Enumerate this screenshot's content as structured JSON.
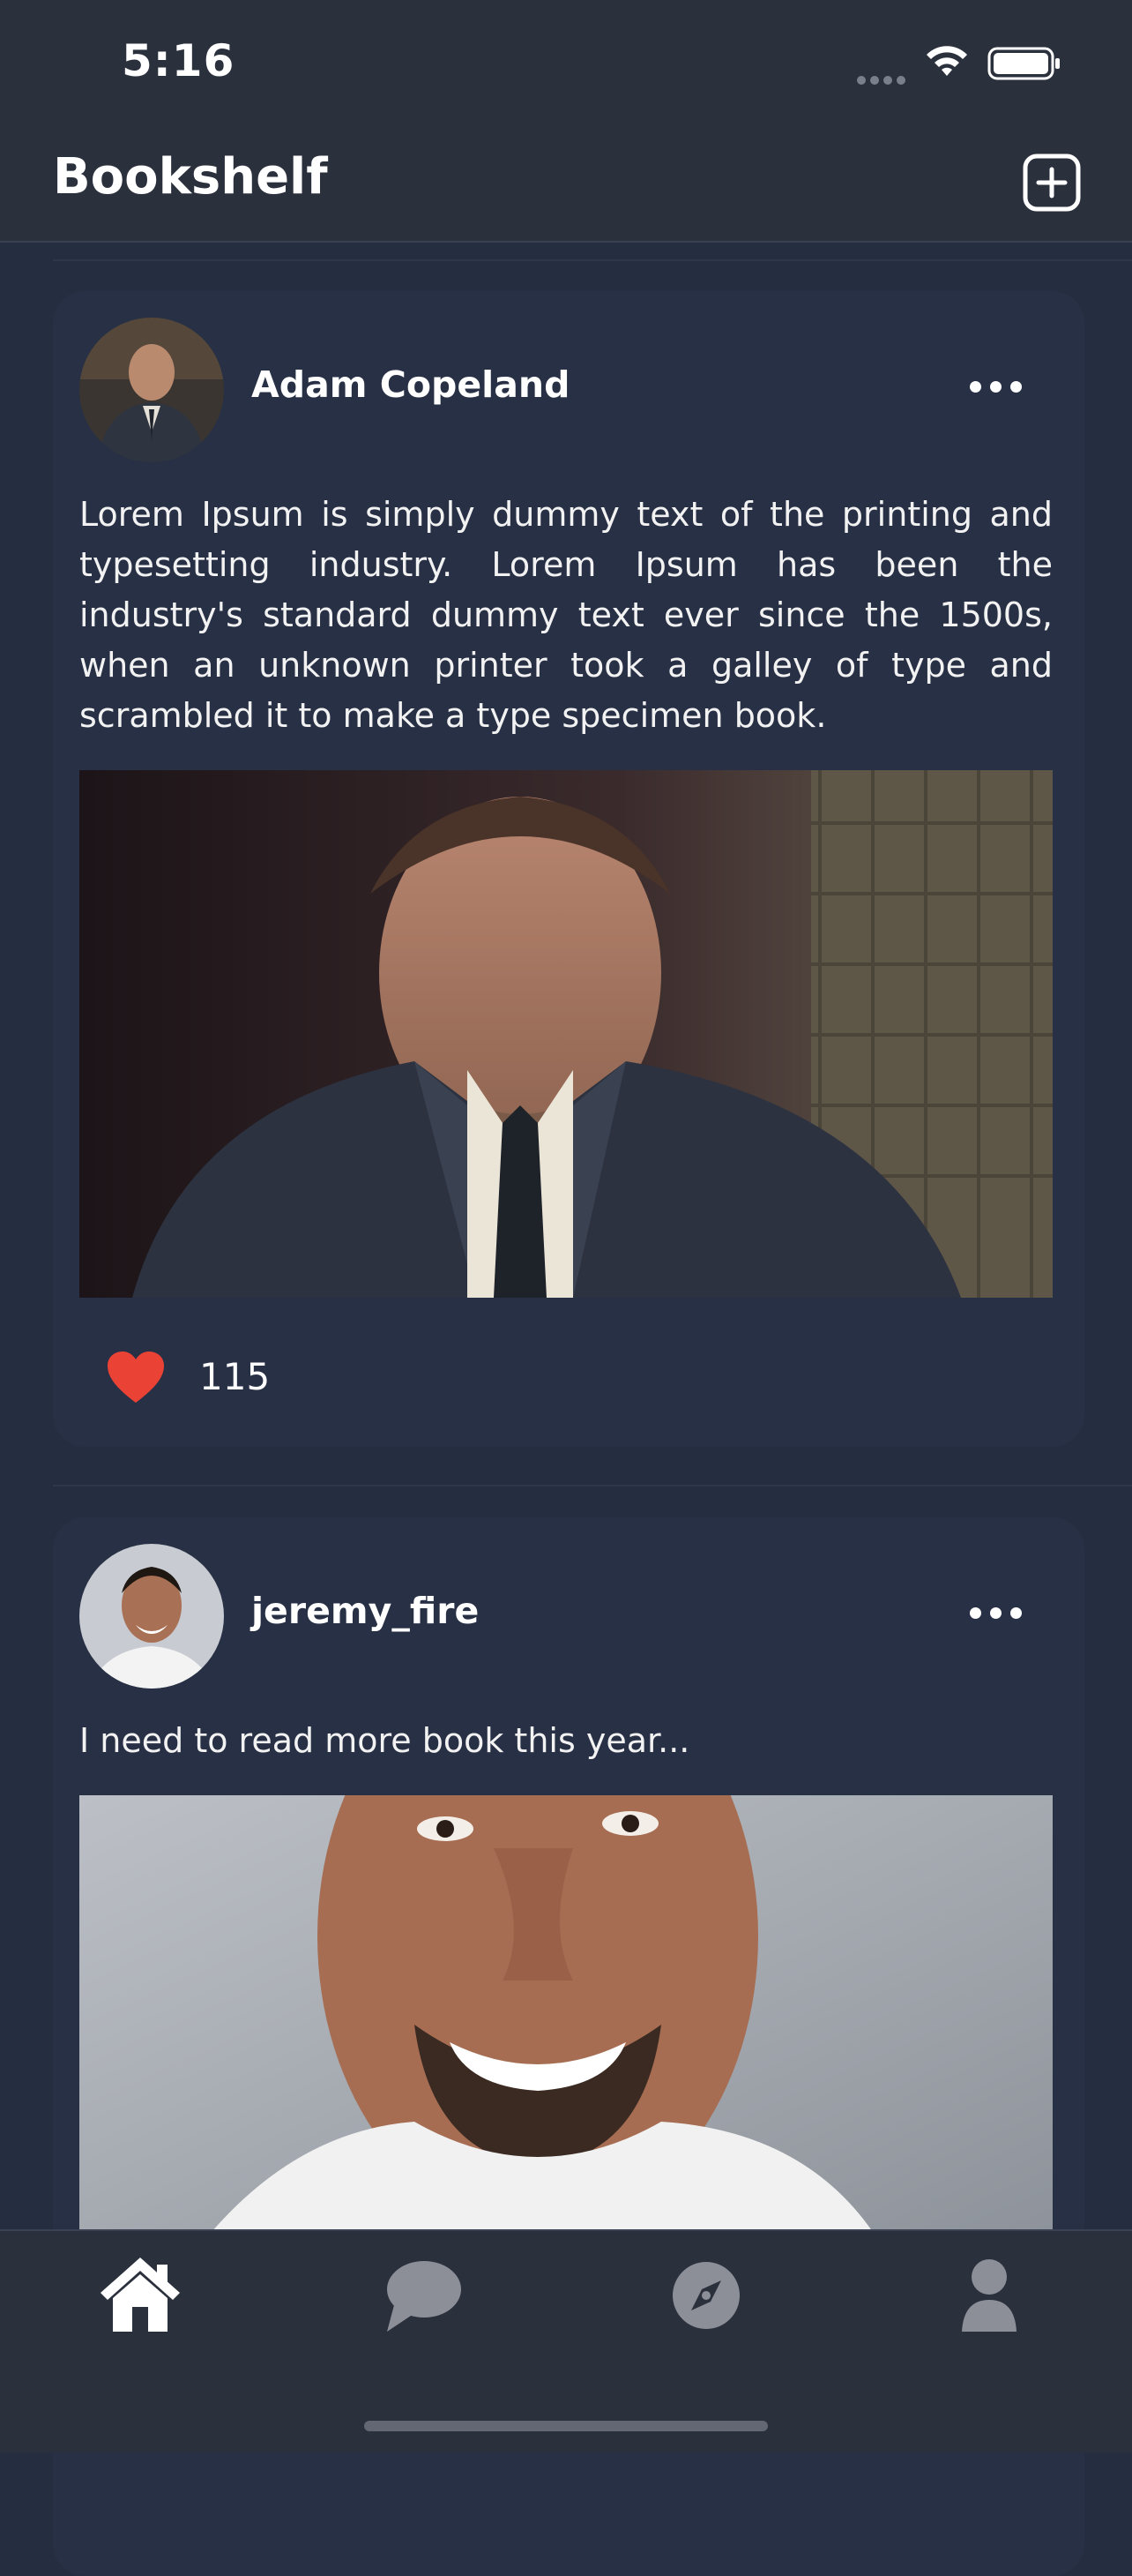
{
  "status_bar": {
    "time": "5:16",
    "icons": [
      "signal-icon",
      "wifi-icon",
      "battery-icon"
    ]
  },
  "nav": {
    "title": "Bookshelf",
    "add_icon": "plus-square-icon"
  },
  "posts": [
    {
      "author": "Adam Copeland",
      "text": "Lorem Ipsum is simply dummy text of the printing and typesetting industry. Lorem Ipsum has been the industry's standard dummy text ever since the 1500s, when an unknown printer took a galley of type and scrambled it to make a type specimen book.",
      "likes": "115",
      "more_icon": "ellipsis-icon",
      "like_icon": "heart-icon"
    },
    {
      "author": "jeremy_fire",
      "text": "I need to read more book this year...",
      "more_icon": "ellipsis-icon"
    }
  ],
  "tab_bar": {
    "items": [
      "home-icon",
      "chat-icon",
      "compass-icon",
      "person-icon"
    ],
    "active": "home-icon"
  },
  "colors": {
    "background": "#252d40",
    "bars": "#2b303d",
    "like": "#ea4335",
    "tab_inactive": "#8c8f97"
  }
}
